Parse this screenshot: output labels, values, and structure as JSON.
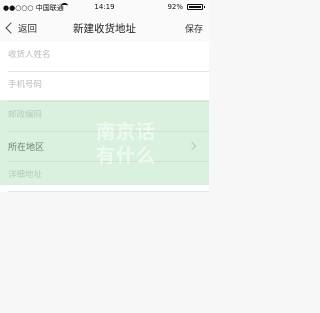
{
  "status_bar": {
    "carrier": "●●○○○ 中国联通",
    "time": "14:19",
    "battery": "92%"
  },
  "nav": {
    "back_label": "返回",
    "title": "新建收货地址",
    "save_label": "保存"
  },
  "form": {
    "name_placeholder": "收货人姓名",
    "phone_placeholder": "手机号码",
    "postcode_placeholder": "邮政编码",
    "region_label": "所在地区",
    "address_placeholder": "详细地址"
  },
  "watermark": {
    "text": "南京话\n有什么"
  }
}
